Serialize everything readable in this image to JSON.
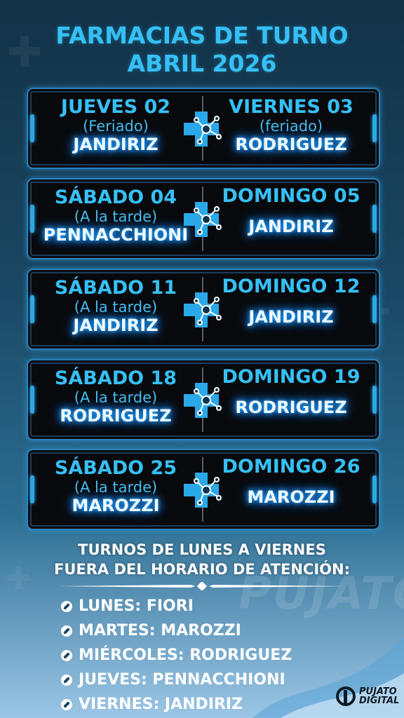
{
  "header": {
    "line1": "FARMACIAS DE TURNO",
    "line2": "ABRIL 2026"
  },
  "cards": [
    {
      "left": {
        "day": "JUEVES 02",
        "note": "(Feriado)",
        "pharmacy": "JANDIRIZ"
      },
      "right": {
        "day": "VIERNES 03",
        "note": "(feriado)",
        "pharmacy": "RODRIGUEZ"
      }
    },
    {
      "left": {
        "day": "SÁBADO 04",
        "note": "(A la tarde)",
        "pharmacy": "PENNACCHIONI"
      },
      "right": {
        "day": "DOMINGO 05",
        "pharmacy": "JANDIRIZ"
      }
    },
    {
      "left": {
        "day": "SÁBADO 11",
        "note": "(A la tarde)",
        "pharmacy": "JANDIRIZ"
      },
      "right": {
        "day": "DOMINGO 12",
        "pharmacy": "JANDIRIZ"
      }
    },
    {
      "left": {
        "day": "SÁBADO 18",
        "note": "(A la tarde)",
        "pharmacy": "RODRIGUEZ"
      },
      "right": {
        "day": "DOMINGO 19",
        "pharmacy": "RODRIGUEZ"
      }
    },
    {
      "left": {
        "day": "SÁBADO 25",
        "note": "(A la tarde)",
        "pharmacy": "MAROZZI"
      },
      "right": {
        "day": "DOMINGO 26",
        "pharmacy": "MAROZZI"
      }
    }
  ],
  "weekday_section": {
    "title_line1": "TURNOS DE LUNES A VIERNES",
    "title_line2": "FUERA DEL HORARIO DE ATENCIÓN:",
    "items": [
      "LUNES: FIORI",
      "MARTES: MAROZZI",
      "MIÉRCOLES: RODRIGUEZ",
      "JUEVES: PENNACCHIONI",
      "VIERNES: JANDIRIZ"
    ]
  },
  "branding": {
    "watermark_text": "PUJATO",
    "logo_line1": "PUJATO",
    "logo_line2": "DIGITAL"
  },
  "icons": {
    "divider_icon": "pharmacy-cross-molecule-icon",
    "bullet_icon": "pill-icon"
  },
  "colors": {
    "accent": "#35c0f5",
    "glow": "#1fa8ff",
    "card_bg": "#08090c",
    "card_border": "#2d7fb8"
  }
}
